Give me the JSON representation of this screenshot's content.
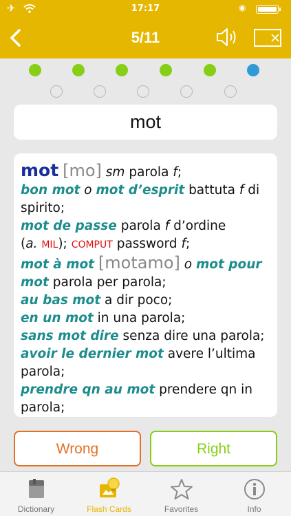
{
  "status_bar": {
    "time": "17:17"
  },
  "nav": {
    "title": "5/11"
  },
  "progress": {
    "row1": [
      "done",
      "done",
      "done",
      "done",
      "done",
      "current"
    ],
    "row2": [
      "pending",
      "pending",
      "pending",
      "pending",
      "pending"
    ]
  },
  "card": {
    "headword": "mot"
  },
  "entry": {
    "headword": "mot",
    "pron1": "[mo]",
    "pos": "sm",
    "t1": "parola",
    "g1": "f",
    "t1_end": ";",
    "p1": "bon mot",
    "o1": "o",
    "p2": "mot d’esprit",
    "t2": "battuta",
    "g2": "f",
    "t2b": "di spirito;",
    "p3": "mot de passe",
    "t3": "parola",
    "g3": "f",
    "t3b": "d’ordine",
    "paren_open": "(",
    "abbr_a": "a.",
    "mil": "MIL",
    "paren_close": ");",
    "comput": "COMPUT",
    "t4": "password",
    "g4": "f",
    "t4_end": ";",
    "p4": "mot à mot",
    "pron2": "[motamo]",
    "o2": "o",
    "p5": "mot pour mot",
    "t5": "parola per parola;",
    "p6": "au bas mot",
    "t6": "a dir poco;",
    "p7": "en un mot",
    "t7": "in una parola;",
    "p8": "sans mot dire",
    "t8": "senza dire una parola;",
    "p9": "avoir le dernier mot",
    "t9": "avere l’ultima parola;",
    "p10": "prendre qn au mot",
    "t10": "prendere qn in parola;"
  },
  "buttons": {
    "wrong": "Wrong",
    "right": "Right"
  },
  "tabs": [
    {
      "label": "Dictionary",
      "icon": "book-icon"
    },
    {
      "label": "Flash Cards",
      "icon": "flash-cards-icon"
    },
    {
      "label": "Favorites",
      "icon": "star-icon"
    },
    {
      "label": "Info",
      "icon": "info-icon"
    }
  ],
  "colors": {
    "header": "#e6b700",
    "done_dot": "#86cf16",
    "current_dot": "#2e9bd6",
    "wrong": "#e07226",
    "right": "#86cf16",
    "phrase": "#1d8c8c",
    "headword": "#1a2f9a",
    "label": "#dd1111"
  }
}
